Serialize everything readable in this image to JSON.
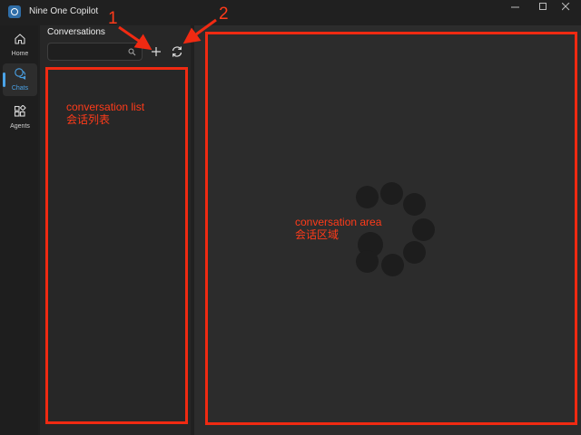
{
  "window": {
    "title": "Nine One Copilot",
    "controls": [
      "minimize-icon",
      "maximize-icon",
      "close-icon"
    ]
  },
  "nav": {
    "items": [
      {
        "label": "Home",
        "icon": "home-icon",
        "active": false
      },
      {
        "label": "Chats",
        "icon": "chat-icon",
        "active": true
      },
      {
        "label": "Agents",
        "icon": "agents-icon",
        "active": false
      }
    ],
    "accent_color": "#4aa3e8"
  },
  "conversations": {
    "title": "Conversations",
    "search_value": "",
    "search_placeholder": "",
    "add_button_icon": "plus-icon",
    "refresh_button_icon": "refresh-icon"
  },
  "annotations": {
    "color": "#f02a12",
    "marker_1": "1",
    "marker_2": "2",
    "list_label_en": "conversation list",
    "list_label_zh": "会话列表",
    "area_label_en": "conversation area",
    "area_label_zh": "会话区域"
  },
  "loading_spinner": {
    "icon": "loading-spinner",
    "state": "loading"
  }
}
